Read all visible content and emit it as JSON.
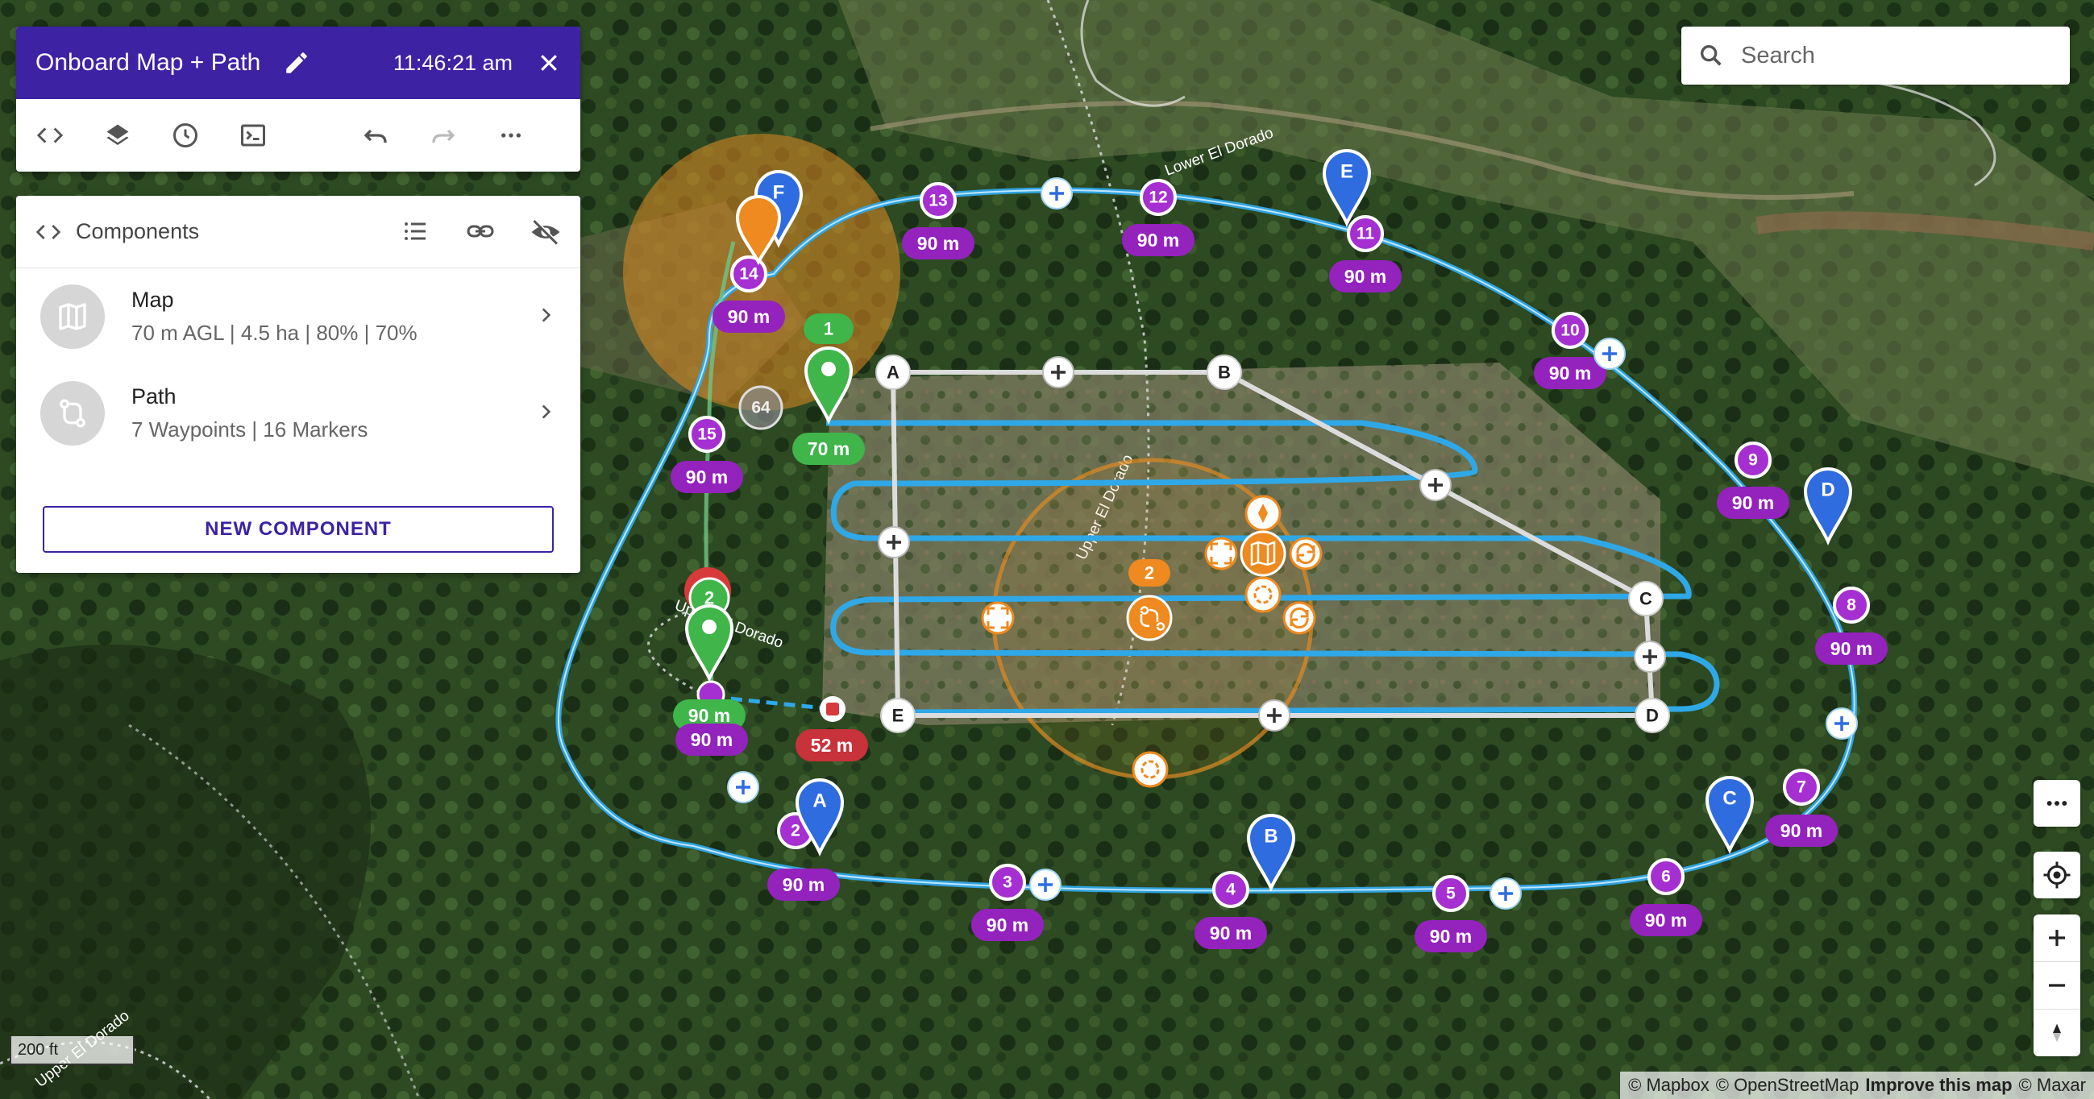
{
  "app": {
    "title": "Onboard Map + Path",
    "time": "11:46:21 am"
  },
  "toolbar": {
    "icons": [
      "code-icon",
      "layers-icon",
      "history-icon",
      "terminal-icon",
      "undo-icon",
      "redo-icon",
      "more-icon"
    ]
  },
  "components": {
    "header": "Components",
    "items": [
      {
        "name": "Map",
        "detail": "70 m AGL | 4.5 ha | 80% | 70%",
        "icon": "map-icon"
      },
      {
        "name": "Path",
        "detail": "7 Waypoints | 16 Markers",
        "icon": "route-icon"
      }
    ],
    "new_button": "NEW COMPONENT"
  },
  "search": {
    "placeholder": "Search"
  },
  "map_labels": {
    "road_lower": "Lower El Dorado",
    "road_upper": "Upper El Dorado",
    "road_mid": "Upper El Dorado",
    "road_bottom": "Upper El Dorado"
  },
  "scale": "200 ft",
  "attribution": {
    "mapbox": "© Mapbox",
    "osm": "© OpenStreetMap",
    "improve": "Improve this map",
    "maxar": "© Maxar"
  },
  "colors": {
    "header": "#3d22a4",
    "path_blue": "#2fa8e8",
    "waypoint_purple": "#a62fd1",
    "label_purple": "#9422bd",
    "marker_blue": "#2f6ce0",
    "marker_green": "#3fb54a",
    "orange": "#ee8a1f",
    "red": "#d63a3a"
  },
  "waypoints": [
    {
      "n": "2",
      "alt": "90 m"
    },
    {
      "n": "3",
      "alt": "90 m"
    },
    {
      "n": "4",
      "alt": "90 m"
    },
    {
      "n": "5",
      "alt": "90 m"
    },
    {
      "n": "6",
      "alt": "90 m"
    },
    {
      "n": "7",
      "alt": "90 m"
    },
    {
      "n": "8",
      "alt": "90 m"
    },
    {
      "n": "9",
      "alt": "90 m"
    },
    {
      "n": "10",
      "alt": "90 m"
    },
    {
      "n": "11",
      "alt": "90 m"
    },
    {
      "n": "12",
      "alt": "90 m"
    },
    {
      "n": "13",
      "alt": "90 m"
    },
    {
      "n": "14",
      "alt": "90 m"
    },
    {
      "n": "15",
      "alt": "90 m"
    }
  ],
  "markers": [
    "A",
    "B",
    "C",
    "D",
    "E",
    "F"
  ],
  "polygon_vertices": [
    "A",
    "B",
    "C",
    "D",
    "E"
  ],
  "other_labels": {
    "green_1": "1",
    "green_1_alt": "70 m",
    "green_2": "2",
    "start_alt_1": "90 m",
    "start_alt_2": "90 m",
    "gray_count": "64",
    "red_alt": "52 m",
    "orange_2": "2"
  }
}
